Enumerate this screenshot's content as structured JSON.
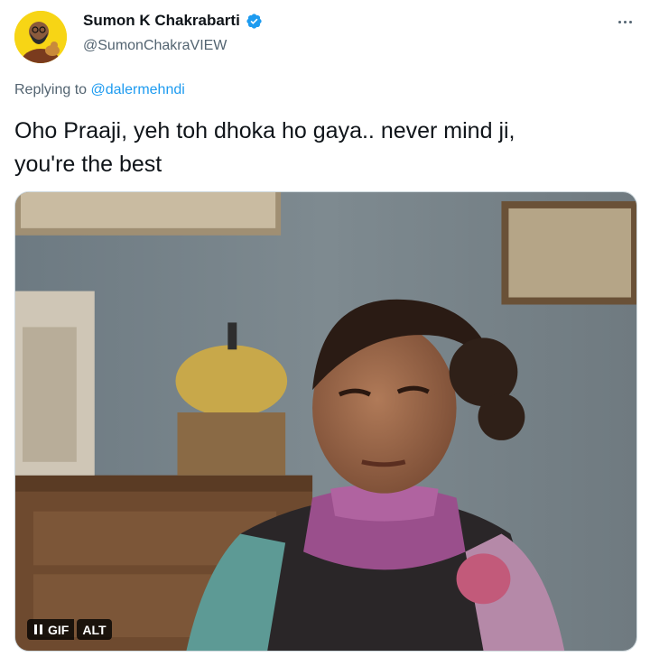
{
  "author": {
    "display_name": "Sumon K Chakrabarti",
    "handle": "@SumonChakraVIEW",
    "verified": true,
    "avatar_icon": "avatar-illustration-icon",
    "avatar_bg": "#f7d515"
  },
  "reply": {
    "prefix": "Replying to ",
    "handle": "@dalermehndi"
  },
  "tweet": {
    "lines": [
      "Oho Praaji, yeh toh dhoka ho gaya.. never mind ji,",
      "you're the best"
    ]
  },
  "media": {
    "type": "gif",
    "controls": {
      "gif_label": "GIF",
      "alt_label": "ALT"
    }
  },
  "colors": {
    "link": "#1d9bf0",
    "secondary_text": "#536471",
    "verified_badge": "#1d9bf0"
  },
  "icons": [
    "more-icon",
    "verified-badge-icon",
    "pause-icon"
  ]
}
